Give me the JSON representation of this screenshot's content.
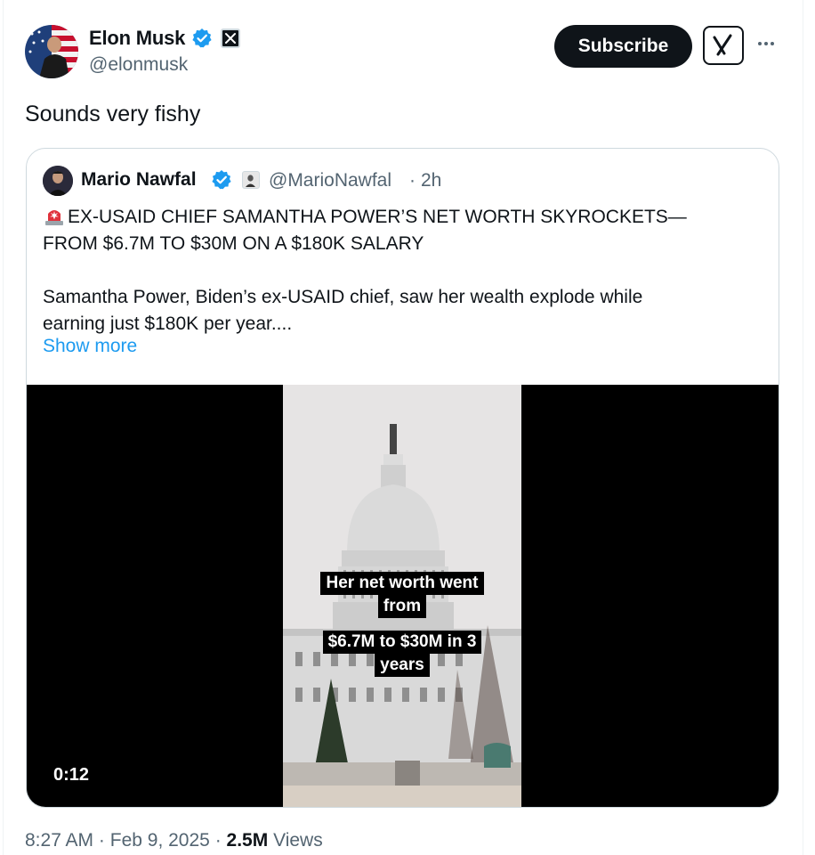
{
  "author": {
    "name": "Elon Musk",
    "handle": "@elonmusk",
    "avatar_icon": "profile-photo-flag-background",
    "verified_color": "#1d9bf0"
  },
  "header": {
    "subscribe_label": "Subscribe",
    "grok_icon": "grok-icon",
    "more_icon": "more-icon"
  },
  "tweet": {
    "text": "Sounds very fishy"
  },
  "quote": {
    "name": "Mario Nawfal",
    "handle": "@MarioNawfal",
    "separator": "·",
    "time": "2h",
    "headline_icon": "siren-emoji",
    "headline_line1": "EX-USAID CHIEF SAMANTHA POWER’S NET WORTH SKYROCKETS—",
    "headline_line2": "FROM $6.7M TO $30M ON A $180K SALARY",
    "body_line1": "Samantha Power, Biden’s ex-USAID chief, saw her wealth explode while",
    "body_line2": "earning just $180K per year....",
    "show_more": "Show more",
    "video": {
      "duration": "0:12",
      "caption1_line1": "Her net worth went",
      "caption1_line2": "from",
      "caption2_line1": "$6.7M to $30M in 3",
      "caption2_line2": "years"
    }
  },
  "footer": {
    "time": "8:27 AM",
    "sep1": "·",
    "date": "Feb 9, 2025",
    "sep2": "·",
    "views_count": "2.5M",
    "views_label": "Views"
  },
  "colors": {
    "text": "#0f1419",
    "secondary": "#536471",
    "link": "#1d9bf0",
    "border": "#cfd9de"
  }
}
